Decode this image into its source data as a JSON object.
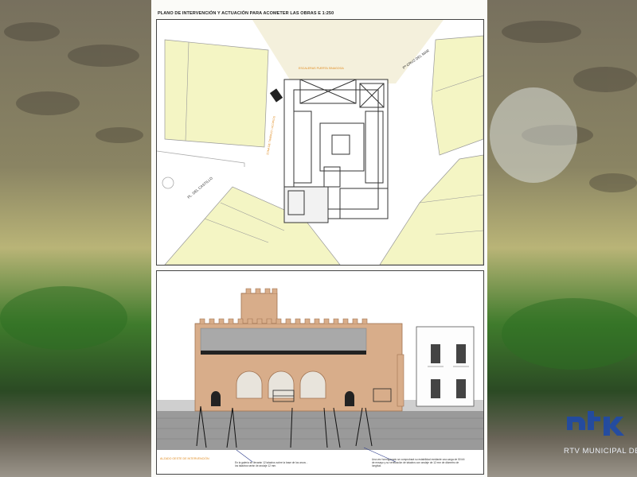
{
  "plan": {
    "title": "PLANO DE INTERVENCIÓN Y ACTUACIÓN PARA ACOMETER LAS OBRAS  E 1:250",
    "street_top": "ESCALERAS PUERTA SINAGOGA",
    "street_right": "Pª CRUZ DEL MAR",
    "street_left": "PL. DEL CASTILLO",
    "vertical_label": "ZONA DE TRABAJO / ACOPIOS"
  },
  "elevation": {
    "caption": "ALZADO OESTE DE INTERVENCIÓN",
    "note_left": "En la galería se llevarán 12 taladros sobre la base de los arcos - los taladros serán de anclaje 12 mm.",
    "note_right": "Una vez hormigonado se comprobará su estabilidad mediante una carga de 50 kN de ensayo y su verificación de taladros con anclaje de 12 mm de diámetro de longitud."
  },
  "brand": {
    "caption": "RTV MUNICIPAL DE CH"
  }
}
